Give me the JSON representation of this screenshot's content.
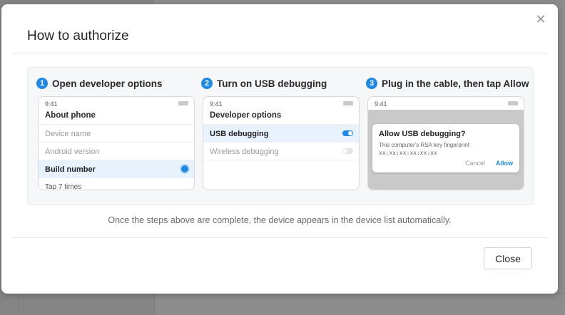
{
  "modal": {
    "title": "How to authorize",
    "close_icon": "close-icon",
    "close_button": "Close",
    "note": "Once the steps above are complete, the device appears in the device list automatically."
  },
  "steps": [
    {
      "number": "1",
      "label": "Open developer options",
      "phone": {
        "time": "9:41",
        "title": "About phone",
        "rows": [
          "Device name",
          "Android version",
          "Build number",
          "Tap 7 times"
        ]
      }
    },
    {
      "number": "2",
      "label": "Turn on USB debugging",
      "phone": {
        "time": "9:41",
        "title": "Developer options",
        "rows": [
          "USB debugging",
          "Wireless debugging"
        ]
      }
    },
    {
      "number": "3",
      "label": "Plug in the cable, then tap Allow",
      "phone": {
        "time": "9:41",
        "dialog": {
          "title": "Allow USB debugging?",
          "text": "This computer's RSA key fingerprint",
          "fingerprint": "xx:xx:xx:xx:xx:xx",
          "cancel": "Cancel",
          "allow": "Allow"
        }
      }
    }
  ],
  "colors": {
    "accent": "#1e88e5",
    "highlight_row": "#e8f2fc",
    "overlay": "#8d8d8d"
  }
}
